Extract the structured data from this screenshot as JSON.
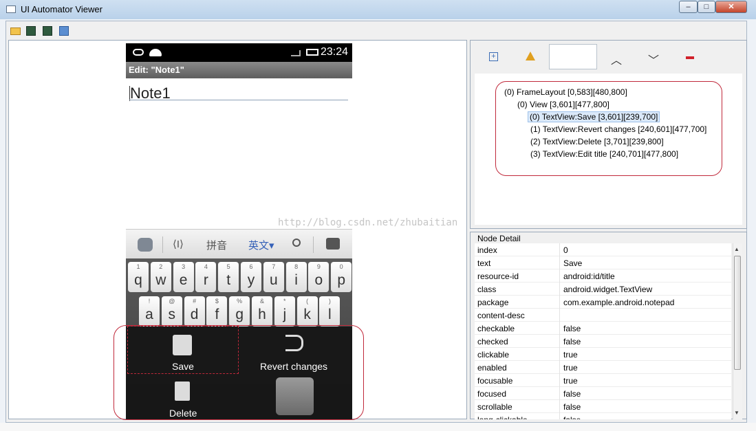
{
  "window": {
    "title": "UI Automator Viewer",
    "minimize": "–",
    "maximize": "□",
    "close": "✕"
  },
  "toolbar": {
    "icons": [
      "open-folder-icon",
      "device-screenshot-icon",
      "device-screenshot-compressed-icon",
      "save-icon"
    ]
  },
  "device": {
    "clock": "23:24",
    "title": "Edit: \"Note1\"",
    "note_text": "Note1",
    "ime_bar": {
      "pinyin": "拼音",
      "english": "英文▾"
    },
    "row1": [
      [
        "1",
        "q"
      ],
      [
        "2",
        "w"
      ],
      [
        "3",
        "e"
      ],
      [
        "4",
        "r"
      ],
      [
        "5",
        "t"
      ],
      [
        "6",
        "y"
      ],
      [
        "7",
        "u"
      ],
      [
        "8",
        "i"
      ],
      [
        "9",
        "o"
      ],
      [
        "0",
        "p"
      ]
    ],
    "row2": [
      [
        "!",
        "a"
      ],
      [
        "@",
        "s"
      ],
      [
        "#",
        "d"
      ],
      [
        "$",
        "f"
      ],
      [
        "%",
        "g"
      ],
      [
        "&",
        "h"
      ],
      [
        "*",
        "j"
      ],
      [
        "(",
        "k"
      ],
      [
        ")",
        "l"
      ]
    ],
    "menu": {
      "save": "Save",
      "revert": "Revert changes",
      "delete": "Delete"
    }
  },
  "watermark": "http://blog.csdn.net/zhubaitian",
  "hierarchy": {
    "nodes": [
      "(0) FrameLayout [0,583][480,800]",
      "(0) View [3,601][477,800]",
      "(0) TextView:Save [3,601][239,700]",
      "(1) TextView:Revert changes [240,601][477,700]",
      "(2) TextView:Delete [3,701][239,800]",
      "(3) TextView:Edit title [240,701][477,800]"
    ]
  },
  "node_detail": {
    "title": "Node Detail",
    "rows": [
      [
        "index",
        "0"
      ],
      [
        "text",
        "Save"
      ],
      [
        "resource-id",
        "android:id/title"
      ],
      [
        "class",
        "android.widget.TextView"
      ],
      [
        "package",
        "com.example.android.notepad"
      ],
      [
        "content-desc",
        ""
      ],
      [
        "checkable",
        "false"
      ],
      [
        "checked",
        "false"
      ],
      [
        "clickable",
        "true"
      ],
      [
        "enabled",
        "true"
      ],
      [
        "focusable",
        "true"
      ],
      [
        "focused",
        "false"
      ],
      [
        "scrollable",
        "false"
      ],
      [
        "long-clickable",
        "false"
      ]
    ]
  },
  "colors": {
    "highlight_outline": "#c0283a",
    "selected_node": "#dbe9f9"
  }
}
